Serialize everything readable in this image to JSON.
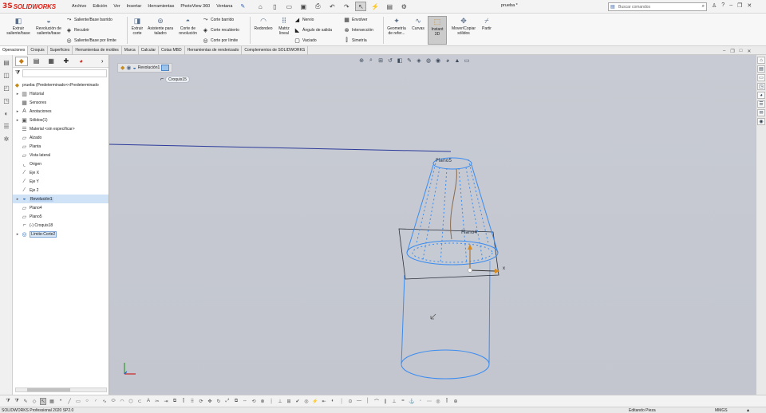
{
  "app": {
    "logo_mark": "3S",
    "logo_text": "SOLIDWORKS",
    "menu": [
      "Archivo",
      "Edición",
      "Ver",
      "Insertar",
      "Herramientas",
      "PhotoView 360",
      "Ventana"
    ],
    "document_title": "prueba *",
    "search_placeholder": "Buscar comandos"
  },
  "commands": {
    "extruir": "Extruir saliente/base",
    "revolucion": "Revolución de saliente/base",
    "barrido": "Saliente/Base barrido",
    "recubrir": "Recubrir",
    "limite": "Saliente/Base por límite",
    "extruir_corte": "Extruir corte",
    "asistente": "Asistente para taladro",
    "corte_rev": "Corte de revolución",
    "corte_barrido": "Corte barrido",
    "corte_recubierto": "Corte recubierto",
    "corte_limite": "Corte por límite",
    "redondeo": "Redondeo",
    "matriz": "Matriz lineal",
    "nervio": "Nervio",
    "angulo": "Ángulo de salida",
    "vaciado": "Vaciado",
    "envolver": "Envolver",
    "interseccion": "Intersección",
    "simetria": "Simetría",
    "geometria": "Geometría de refer...",
    "curvas": "Curvas",
    "instant3d": "Instant 3D",
    "mover": "Mover/Copiar sólidos",
    "partir": "Partir"
  },
  "tabs": [
    "Operaciones",
    "Croquis",
    "Superficies",
    "Herramientas de moldes",
    "Marca",
    "Calcular",
    "Cotas MBD",
    "Herramientas de renderizado",
    "Complementos de SOLIDWORKS"
  ],
  "tree": {
    "root": "prueba (Predeterminado<<Predeterminado",
    "items": [
      "Historial",
      "Sensores",
      "Anotaciones",
      "Sólidos(1)",
      "Material <sin especificar>",
      "Alzado",
      "Planta",
      "Vista lateral",
      "Origen",
      "Eje X",
      "Eje Y",
      "Eje 2",
      "Revolución1",
      "Plano4",
      "Plano5",
      "(-) Croquis18",
      "Límite-Corte2"
    ]
  },
  "breadcrumb": {
    "feature": "Revolución1",
    "sketch": "Croquis15"
  },
  "viewport": {
    "plane5_label": "Plano5",
    "plane4_label": "Plano4",
    "axis_x_label": "x"
  },
  "status": {
    "app_version": "SOLIDWORKS Professional 2020 SP2.0",
    "mode": "Editando Pieza",
    "units": "MMGS"
  },
  "colors": {
    "accent_red": "#d9261c",
    "sketch_blue": "#3b8cf0",
    "selection_blue": "#cfe2f6"
  }
}
